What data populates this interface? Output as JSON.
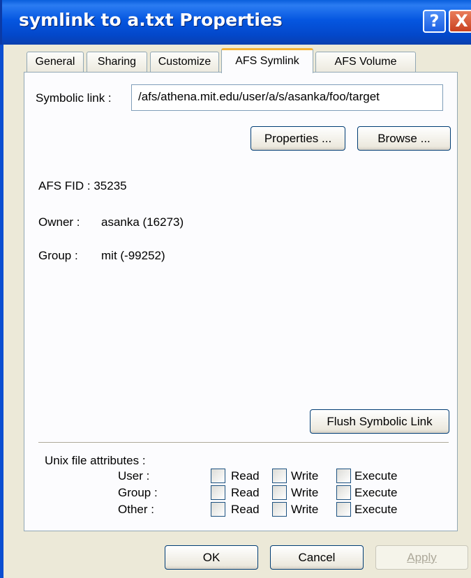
{
  "window": {
    "title": "symlink to a.txt Properties",
    "help_glyph": "?",
    "close_glyph": "X"
  },
  "tabs": [
    {
      "label": "General"
    },
    {
      "label": "Sharing"
    },
    {
      "label": "Customize"
    },
    {
      "label": "AFS Symlink",
      "active": true
    },
    {
      "label": "AFS Volume"
    }
  ],
  "symlink": {
    "label": "Symbolic link :",
    "value": "/afs/athena.mit.edu/user/a/s/asanka/foo/target",
    "properties_button": "Properties ...",
    "browse_button": "Browse ..."
  },
  "info": {
    "fid": "AFS FID : 35235",
    "owner_label": "Owner :",
    "owner_value": "asanka (16273)",
    "group_label": "Group :",
    "group_value": "mit (-99252)"
  },
  "flush_button": "Flush Symbolic Link",
  "unix": {
    "heading": "Unix file attributes :",
    "rows": [
      {
        "label": "User :",
        "read": "Read",
        "write": "Write",
        "execute": "Execute"
      },
      {
        "label": "Group :",
        "read": "Read",
        "write": "Write",
        "execute": "Execute"
      },
      {
        "label": "Other :",
        "read": "Read",
        "write": "Write",
        "execute": "Execute"
      }
    ]
  },
  "footer": {
    "ok": "OK",
    "cancel": "Cancel",
    "apply": "Apply"
  },
  "colors": {
    "titlebar": "#0556e0",
    "dialog_bg": "#ece9d8",
    "active_tab_accent": "#f5b335"
  }
}
